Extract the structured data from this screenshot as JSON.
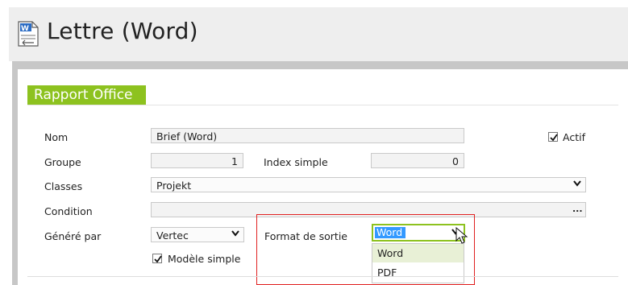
{
  "header": {
    "title": "Lettre (Word)",
    "icon": "word-document-icon"
  },
  "section": {
    "title": "Rapport Office",
    "accent": "#8dc21f"
  },
  "form": {
    "nom_label": "Nom",
    "nom_value": "Brief (Word)",
    "actif_label": "Actif",
    "actif_checked": true,
    "groupe_label": "Groupe",
    "groupe_value": "1",
    "index_label": "Index simple",
    "index_value": "0",
    "classes_label": "Classes",
    "classes_value": "Projekt",
    "condition_label": "Condition",
    "condition_value": "",
    "condition_button": "...",
    "genere_label": "Généré par",
    "genere_value": "Vertec",
    "modele_label": "Modèle simple",
    "modele_checked": true,
    "format_label": "Format de sortie",
    "format_value": "Word",
    "format_options": [
      "Word",
      "PDF"
    ]
  },
  "colors": {
    "highlight_border": "#e02020",
    "selection": "#3399ff"
  }
}
